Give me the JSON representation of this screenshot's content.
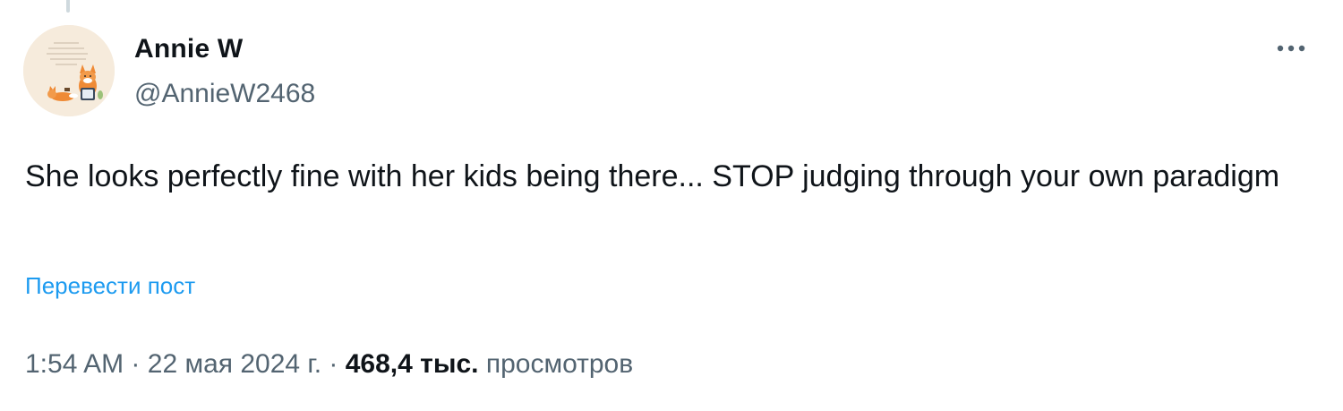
{
  "tweet": {
    "author": {
      "display_name": "Annie W",
      "handle": "@AnnieW2468",
      "avatar_icon": "cartoon-fox-avatar"
    },
    "more_icon": "more-horizontal-icon",
    "text": "She looks perfectly fine with her kids being there... STOP judging through your own paradigm",
    "translate_label": "Перевести пост",
    "time": "1:54 AM",
    "separator": "·",
    "date": "22 мая 2024 г.",
    "views_count": "468,4 тыс.",
    "views_label": "просмотров"
  },
  "colors": {
    "text_primary": "#0f1419",
    "text_secondary": "#536471",
    "link": "#1d9bf0"
  }
}
